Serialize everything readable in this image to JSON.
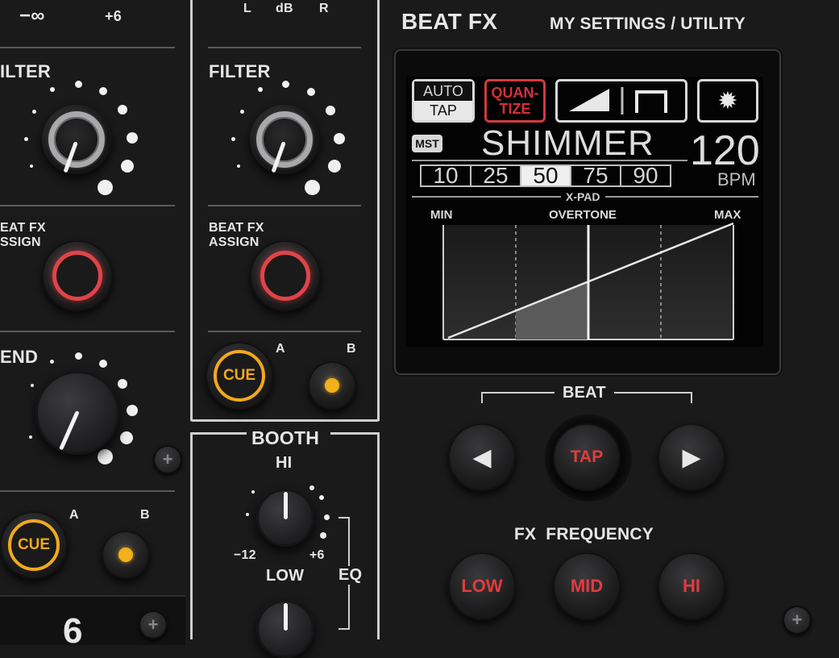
{
  "left_column": {
    "scale_min": "−∞",
    "scale_max": "+6",
    "filter_label": "ILTER",
    "beat_fx_assign_line1": "EAT FX",
    "beat_fx_assign_line2": "SSIGN",
    "send_label": "END",
    "cue_label": "CUE",
    "a_label": "A",
    "b_label": "B",
    "channel_number": "6"
  },
  "middle_column": {
    "meter_l": "L",
    "meter_db": "dB",
    "meter_r": "R",
    "filter_label": "FILTER",
    "beat_fx_assign_line1": "BEAT FX",
    "beat_fx_assign_line2": "ASSIGN",
    "cue_label": "CUE",
    "a_label": "A",
    "b_label": "B"
  },
  "booth": {
    "title": "BOOTH",
    "hi_label": "HI",
    "low_label": "LOW",
    "eq_label": "EQ",
    "scale_min": "−12",
    "scale_max": "+6"
  },
  "beat_fx": {
    "title": "BEAT FX",
    "settings_label": "MY SETTINGS / UTILITY",
    "screen": {
      "auto_label": "AUTO",
      "tap_label": "TAP",
      "quantize_line1": "QUAN-",
      "quantize_line2": "TIZE",
      "mst_badge": "MST",
      "effect_name": "SHIMMER",
      "bpm_value": "120",
      "bpm_unit": "BPM",
      "pads": [
        "10",
        "25",
        "50",
        "75",
        "90"
      ],
      "selected_pad": "50",
      "xpad_label": "X-PAD",
      "graph_min": "MIN",
      "graph_param": "OVERTONE",
      "graph_max": "MAX",
      "graph_level": 0.5
    },
    "beat_label": "BEAT",
    "beat_left_symbol": "◀",
    "tap_button": "TAP",
    "beat_right_symbol": "▶",
    "fx_frequency_label": "FX  FREQUENCY",
    "freq_low": "LOW",
    "freq_mid": "MID",
    "freq_hi": "HI"
  },
  "colors": {
    "panel_bg": "#1a1a1b",
    "accent_red": "#e23b3f",
    "accent_yellow": "#f1a91c",
    "screen_text": "#d5d5d5"
  }
}
